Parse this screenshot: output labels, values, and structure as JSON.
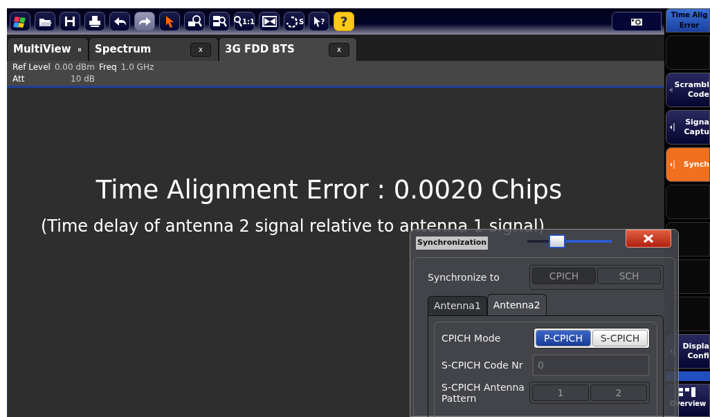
{
  "toolbar": [
    {
      "kind": "flag",
      "active": false
    },
    {
      "kind": "folder",
      "active": false
    },
    {
      "kind": "floppy",
      "active": false
    },
    {
      "kind": "printer",
      "active": false
    },
    {
      "kind": "undo",
      "active": false
    },
    {
      "kind": "redo",
      "active": true
    },
    {
      "kind": "pointer",
      "active": false
    },
    {
      "kind": "zoom",
      "active": false
    },
    {
      "kind": "multizoom",
      "active": false
    },
    {
      "kind": "zoom11",
      "label": "1:1",
      "active": false
    },
    {
      "kind": "fullscreen",
      "active": false
    },
    {
      "kind": "update",
      "label": "S",
      "active": false
    },
    {
      "kind": "helppointer",
      "label": "?",
      "active": false
    },
    {
      "kind": "help",
      "label": "?",
      "active": false
    }
  ],
  "tabs": [
    {
      "label": "MultiView",
      "kind": "multiview",
      "selected": false
    },
    {
      "label": "Spectrum",
      "kind": "channel",
      "close": "x",
      "selected": false
    },
    {
      "label": "3G FDD BTS",
      "kind": "channel",
      "close": "x",
      "selected": true
    }
  ],
  "info": [
    [
      {
        "label": "Ref Level",
        "value": "0.00 dBm"
      },
      {
        "label": "Freq",
        "value": "1.0 GHz"
      }
    ],
    [
      {
        "label": "Att",
        "value": "10 dB"
      }
    ]
  ],
  "result": {
    "title": "Time Alignment Error : 0.0020 Chips",
    "subtitle": "(Time delay of antenna 2 signal relative to antenna 1 signal)"
  },
  "dialog": {
    "title": "Synchronization",
    "transparency": {
      "level": 0.35
    },
    "sync_to": {
      "label": "Synchronize to",
      "disabled": true,
      "options": [
        {
          "label": "CPICH",
          "selected": true
        },
        {
          "label": "SCH",
          "selected": false
        }
      ]
    },
    "tabs": [
      {
        "label": "Antenna1",
        "selected": false
      },
      {
        "label": "Antenna2",
        "selected": true
      }
    ],
    "cpich_mode": {
      "label": "CPICH Mode",
      "options": [
        {
          "label": "P-CPICH",
          "selected": true
        },
        {
          "label": "S-CPICH",
          "selected": false
        }
      ]
    },
    "code_nr": {
      "label": "S-CPICH Code Nr",
      "value": "0",
      "disabled": true
    },
    "pattern": {
      "label": "S-CPICH Antenna Pattern",
      "disabled": true,
      "options": [
        {
          "label": "1",
          "selected": false
        },
        {
          "label": "2",
          "selected": false
        }
      ]
    }
  },
  "softkeys": [
    {
      "kind": "header",
      "lines": [
        "Time Alig",
        "Error"
      ]
    },
    {
      "kind": "empty"
    },
    {
      "kind": "key",
      "lines": [
        "Scrambl",
        "Code"
      ],
      "selected": false
    },
    {
      "kind": "key",
      "lines": [
        "Signa",
        "Captu"
      ],
      "selected": false
    },
    {
      "kind": "key",
      "lines": [
        "Synch"
      ],
      "selected": true
    },
    {
      "kind": "empty"
    },
    {
      "kind": "empty"
    },
    {
      "kind": "empty"
    },
    {
      "kind": "empty"
    },
    {
      "kind": "key",
      "lines": [
        "Displa",
        "Confi"
      ],
      "selected": false
    },
    {
      "kind": "bar"
    },
    {
      "kind": "overview",
      "lines": [
        "Overview"
      ]
    }
  ]
}
